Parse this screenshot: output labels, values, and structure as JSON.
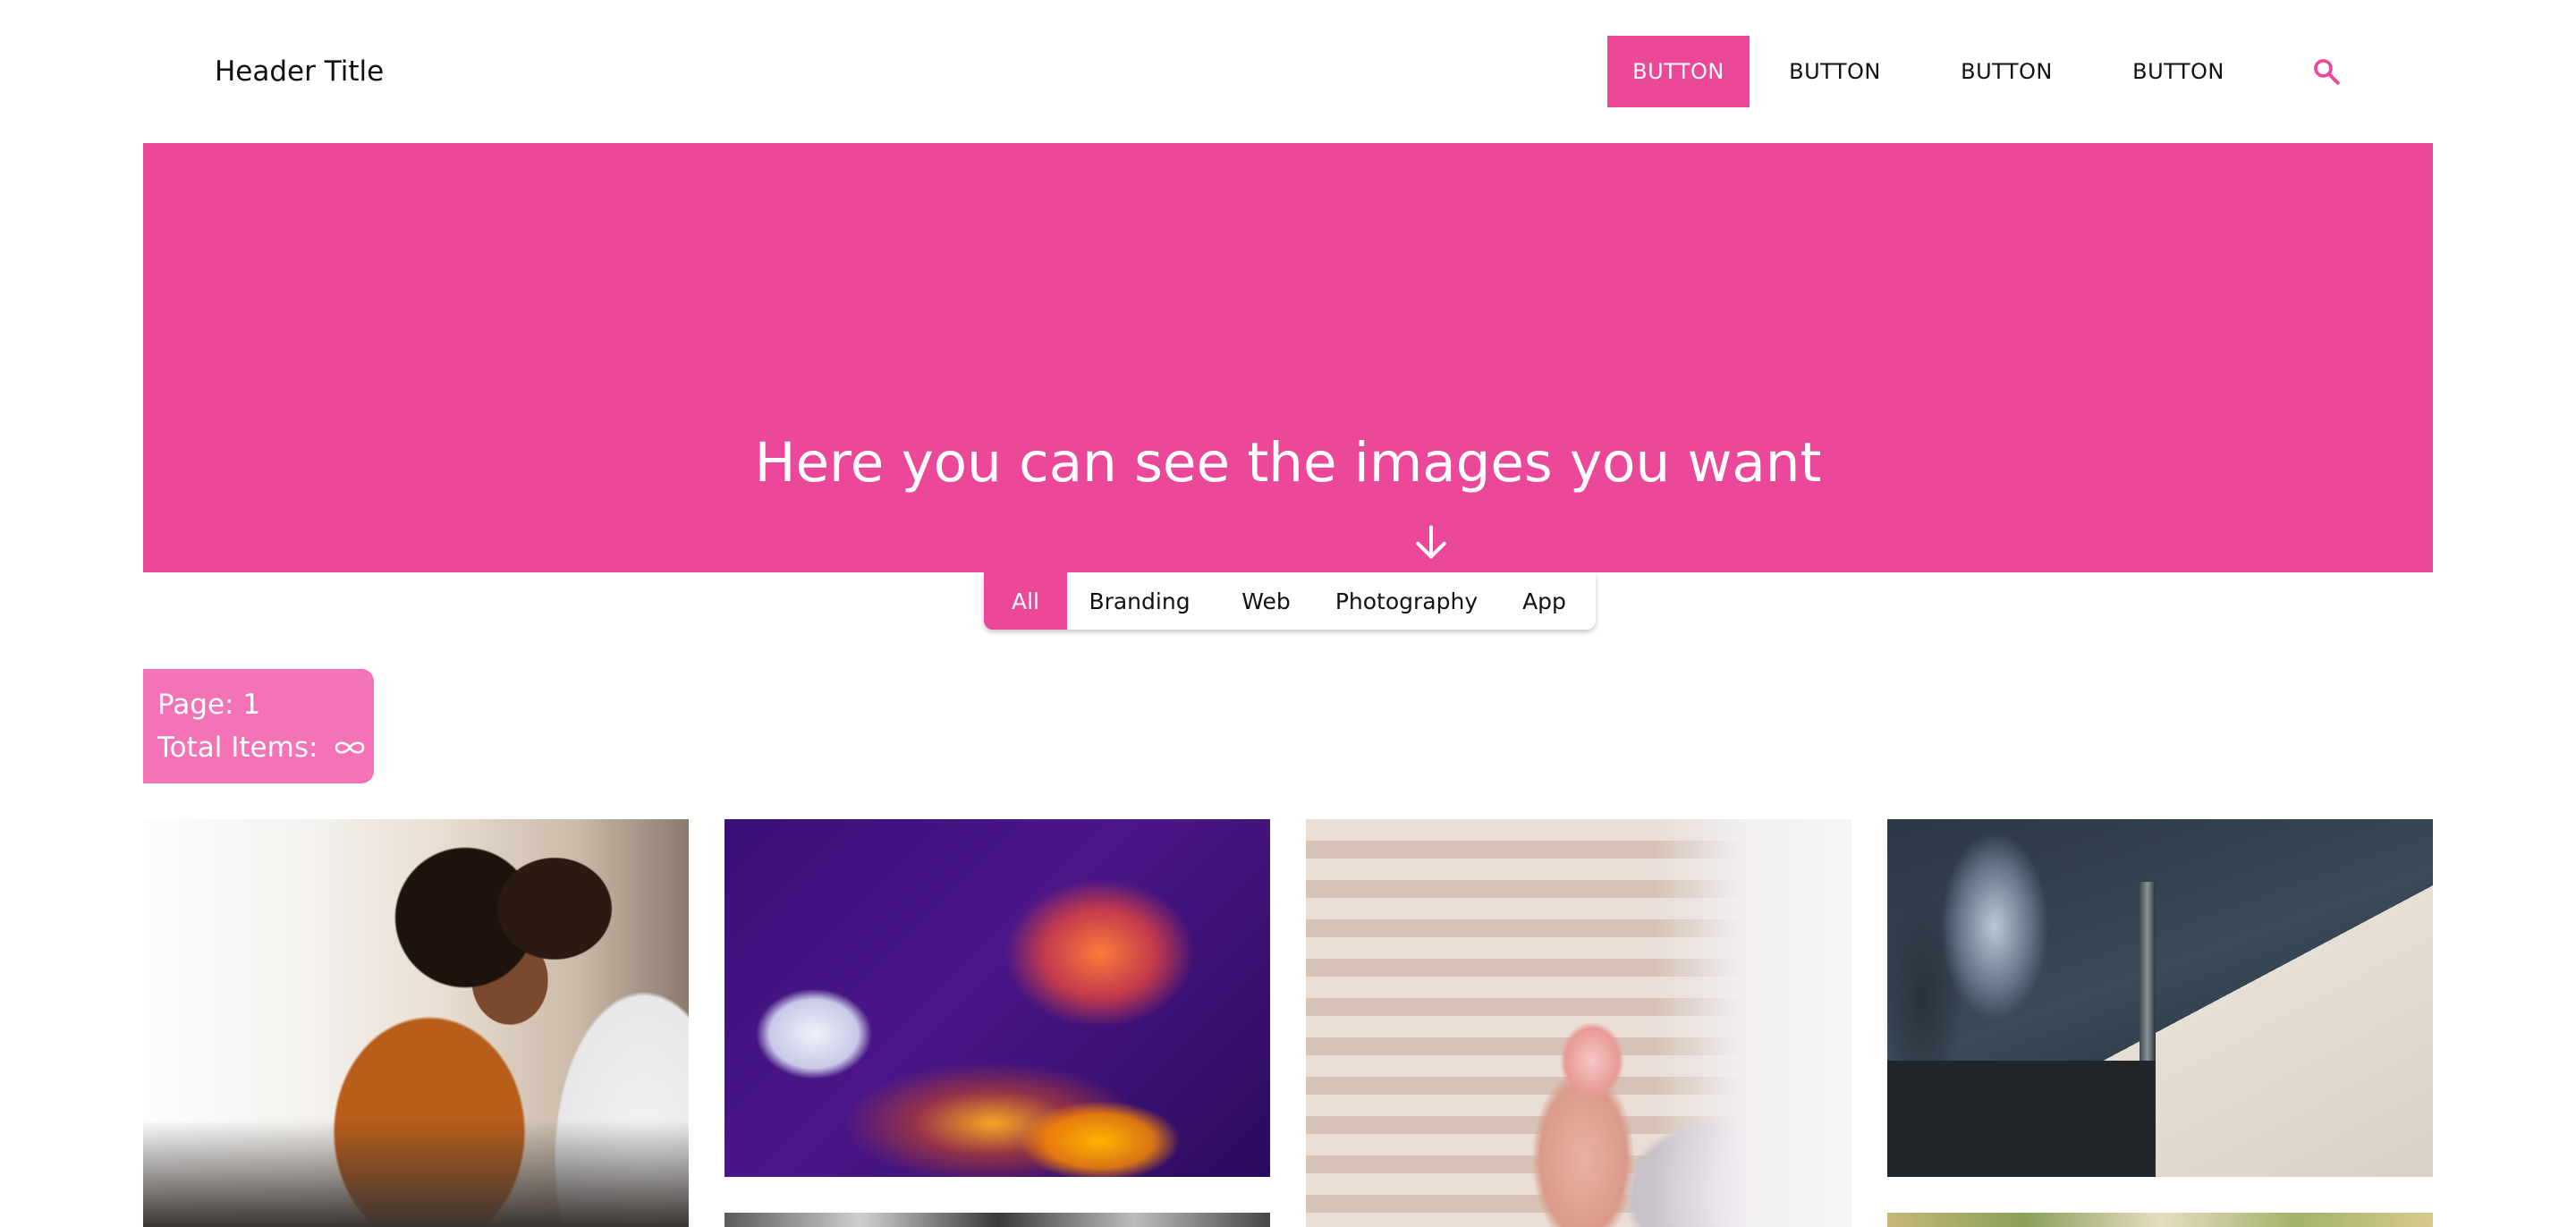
{
  "header": {
    "title": "Header Title",
    "nav": [
      "BUTTON",
      "BUTTON",
      "BUTTON",
      "BUTTON"
    ],
    "active_index": 0,
    "search_icon": "search-icon"
  },
  "hero": {
    "title": "Here you can see the images you want",
    "arrow_icon": "arrow-down-icon"
  },
  "filters": {
    "items": [
      "All",
      "Branding",
      "Web",
      "Photography",
      "App"
    ],
    "active": "All"
  },
  "page_info": {
    "page_label": "Page: 1",
    "total_label": "Total Items:",
    "total_icon": "infinity-icon"
  },
  "gallery": {
    "images": [
      "couple-cooking-photo",
      "dj-neon-photo",
      "holding-hands-photo",
      "street-sign-photo",
      "grayscale-photo",
      "park-photo"
    ]
  },
  "colors": {
    "accent": "#ec4899",
    "accent_light": "#f472b6",
    "text": "#111111",
    "background": "#ffffff"
  }
}
